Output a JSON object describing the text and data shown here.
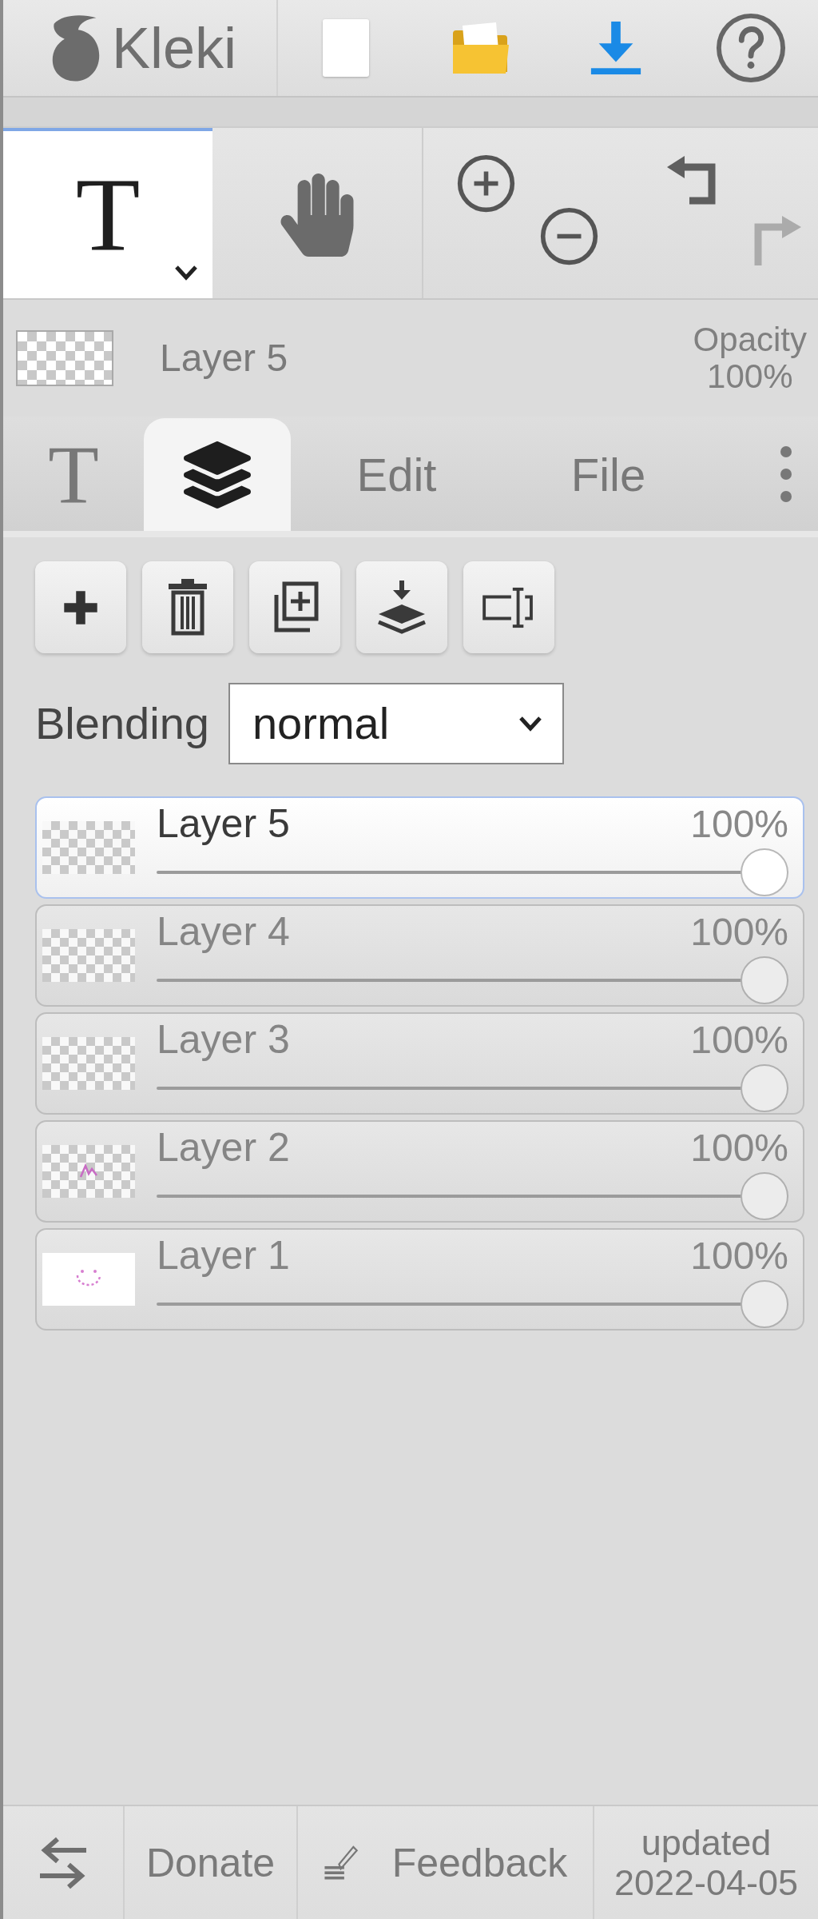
{
  "top_bar": {
    "logo_text": "Kleki"
  },
  "tools": [
    {
      "kind": "text",
      "label": "T",
      "selected": true
    },
    {
      "kind": "hand",
      "selected": false
    }
  ],
  "history": [
    {
      "kind": "undo",
      "disabled": false
    },
    {
      "kind": "redo",
      "disabled": true
    }
  ],
  "current_layer": {
    "name": "Layer 5",
    "opacity_label": "Opacity",
    "opacity": "100%"
  },
  "tabs": [
    {
      "kind": "glyph",
      "label": "T",
      "selected": false
    },
    {
      "kind": "layers",
      "selected": true
    },
    {
      "kind": "text",
      "label": "Edit",
      "selected": false
    },
    {
      "kind": "text",
      "label": "File",
      "selected": false
    }
  ],
  "blending": {
    "label": "Blending",
    "value": "normal"
  },
  "layers": [
    {
      "name": "Layer 5",
      "opacity": "100%",
      "level": 1,
      "selected": true,
      "kind": "transparent"
    },
    {
      "name": "Layer 4",
      "opacity": "100%",
      "level": 1,
      "selected": false,
      "kind": "transparent"
    },
    {
      "name": "Layer 3",
      "opacity": "100%",
      "level": 1,
      "selected": false,
      "kind": "transparent"
    },
    {
      "name": "Layer 2",
      "opacity": "100%",
      "level": 1,
      "selected": false,
      "kind": "sketch"
    },
    {
      "name": "Layer 1",
      "opacity": "100%",
      "level": 1,
      "selected": false,
      "kind": "background"
    }
  ],
  "footer": {
    "donate": "Donate",
    "feedback": "Feedback",
    "updated": "updated",
    "date": "2022-04-05"
  }
}
